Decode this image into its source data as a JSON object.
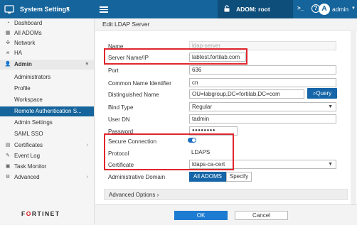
{
  "topbar": {
    "app_title": "System Settings",
    "adom_label": "ADOM: root",
    "terminal": ">_",
    "help": "?",
    "avatar_letter": "A",
    "username": "admin"
  },
  "sidebar": {
    "items": [
      {
        "label": "Dashboard",
        "icon": "dashboard-icon"
      },
      {
        "label": "All ADOMs",
        "icon": "grid-icon"
      },
      {
        "label": "Network",
        "icon": "network-icon"
      },
      {
        "label": "HA",
        "icon": "ha-icon"
      },
      {
        "label": "Admin",
        "icon": "user-icon"
      },
      {
        "label": "Administrators"
      },
      {
        "label": "Profile"
      },
      {
        "label": "Workspace"
      },
      {
        "label": "Remote Authentication S..."
      },
      {
        "label": "Admin Settings"
      },
      {
        "label": "SAML SSO"
      },
      {
        "label": "Certificates",
        "icon": "certificate-icon"
      },
      {
        "label": "Event Log",
        "icon": "event-log-icon"
      },
      {
        "label": "Task Monitor",
        "icon": "task-icon"
      },
      {
        "label": "Advanced",
        "icon": "advanced-icon"
      }
    ],
    "brand": {
      "pre": "F",
      "mid": "RTINET",
      "o": "O"
    }
  },
  "panel": {
    "title": "Edit LDAP Server",
    "fields": {
      "name": {
        "label": "Name",
        "value": "ldap-server"
      },
      "server": {
        "label": "Server Name/IP",
        "value": "labtest.fortilab.com"
      },
      "port": {
        "label": "Port",
        "value": "636"
      },
      "cn": {
        "label": "Common Name Identifier",
        "value": "cn"
      },
      "dn": {
        "label": "Distinguished Name",
        "value": "OU=labgroup,DC=fortilab,DC=com"
      },
      "bind": {
        "label": "Bind Type",
        "value": "Regular"
      },
      "userdn": {
        "label": "User DN",
        "value": "tadmin"
      },
      "password": {
        "label": "Password",
        "value": "●●●●●●●●"
      },
      "secure": {
        "label": "Secure Connection",
        "value": true
      },
      "protocol": {
        "label": "Protocol",
        "value": "LDAPS"
      },
      "certificate": {
        "label": "Certificate",
        "value": "ldaps-ca-cert"
      },
      "adom": {
        "label": "Administrative Domain"
      }
    },
    "query_button": "Query",
    "all_adoms_button": "All ADOMS",
    "specify_button": "Specify",
    "advanced_options": "Advanced Options",
    "ok": "OK",
    "cancel": "Cancel"
  },
  "colors": {
    "topbar": "#15649b",
    "accent": "#1565a8",
    "highlight": "#e0262d"
  }
}
